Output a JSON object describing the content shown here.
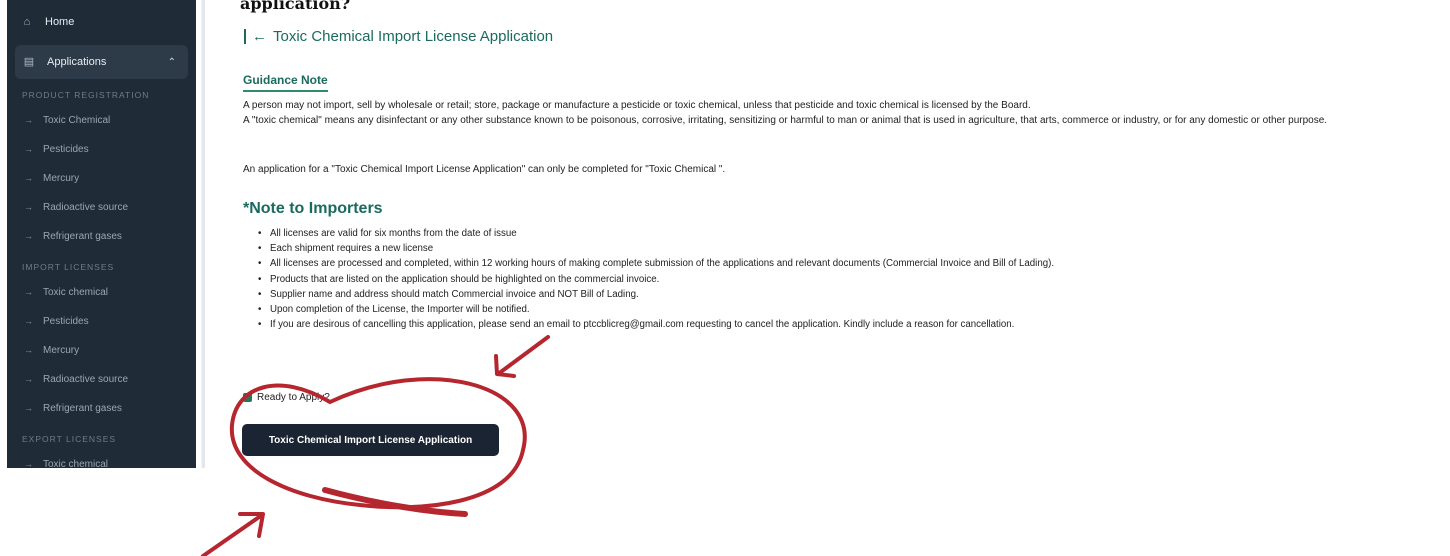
{
  "top_heading_fragment": "application?",
  "sidebar": {
    "home_label": "Home",
    "applications_label": "Applications",
    "sections": [
      {
        "title": "PRODUCT REGISTRATION",
        "items": [
          "Toxic Chemical",
          "Pesticides",
          "Mercury",
          "Radioactive source",
          "Refrigerant gases"
        ]
      },
      {
        "title": "IMPORT LICENSES",
        "items": [
          "Toxic chemical",
          "Pesticides",
          "Mercury",
          "Radioactive source",
          "Refrigerant gases"
        ]
      },
      {
        "title": "EXPORT LICENSES",
        "items": [
          "Toxic chemical"
        ]
      }
    ]
  },
  "page": {
    "title": "Toxic Chemical Import License Application",
    "guidance_heading": "Guidance Note",
    "guidance_p1": "A person may not import, sell by wholesale or retail; store, package or manufacture a pesticide or toxic chemical, unless that pesticide and toxic chemical is licensed by the Board.",
    "guidance_p2": "A \"toxic chemical\" means any disinfectant or any other substance known to be poisonous, corrosive, irritating, sensitizing or harmful to man or animal that is used in agriculture, that arts, commerce or industry, or for any domestic or other purpose.",
    "guidance_p3": "An application for a \"Toxic Chemical Import License Application\" can only be completed for \"Toxic Chemical \".",
    "note_heading": "*Note to Importers",
    "notes": [
      "All licenses are valid for six months from the date of issue",
      "Each shipment requires a new license",
      "All licenses are processed and completed, within 12 working hours of making complete submission of the applications and relevant documents (Commercial Invoice and Bill of Lading).",
      "Products that are listed on the application should be highlighted on the commercial invoice.",
      "Supplier name and address should match Commercial invoice and NOT Bill of Lading.",
      "Upon completion of the License, the Importer will be notified.",
      "If you are desirous of cancelling this application, please send an email to ptccblicreg@gmail.com requesting to cancel the application. Kindly include a reason for cancellation."
    ],
    "ready_label": "Ready to Apply?",
    "apply_button": "Toxic Chemical Import License Application"
  },
  "colors": {
    "sidebar_bg": "#1f2b37",
    "accent_green": "#1a6b5e",
    "button_bg": "#1b2432",
    "annotation_red": "#b5262e"
  },
  "icons": [
    "home-icon",
    "document-icon",
    "chevron-up-icon",
    "arrow-right-icon",
    "arrow-left-icon",
    "checkbox-checked-icon"
  ]
}
